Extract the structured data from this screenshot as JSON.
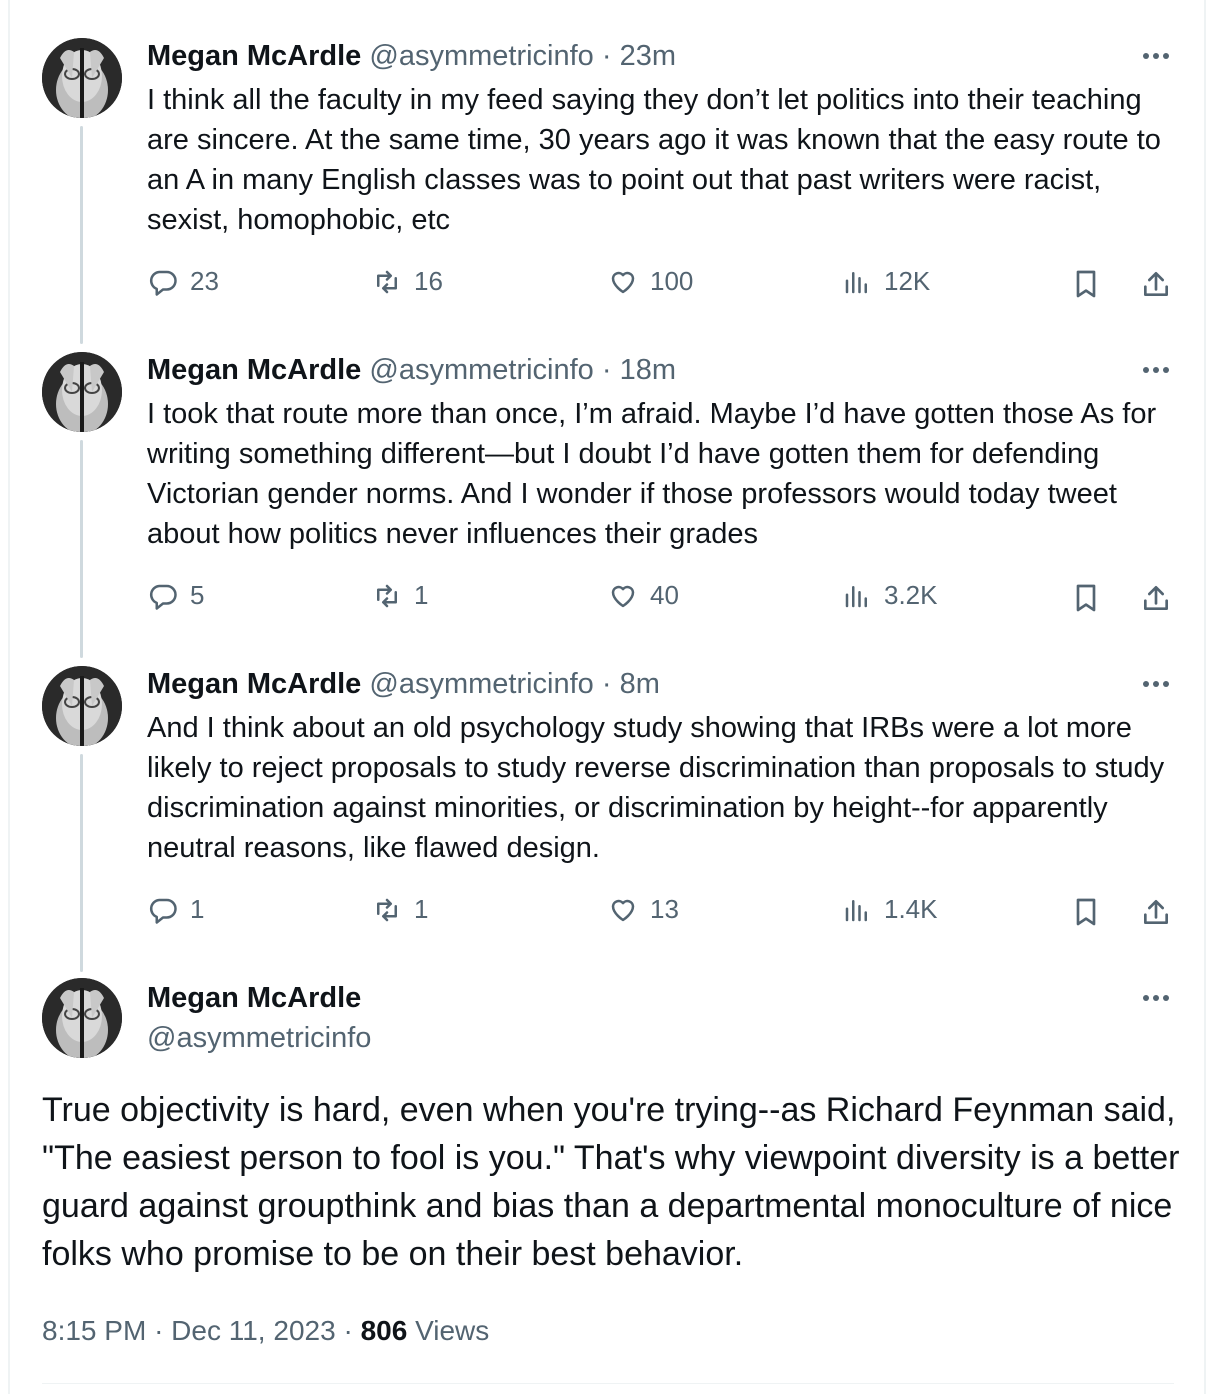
{
  "thread": [
    {
      "name": "Megan McArdle",
      "handle": "@asymmetricinfo",
      "dot": "·",
      "time": "23m",
      "text": "I think all the faculty in my feed saying they don’t let politics into their teaching are sincere. At the same time, 30 years ago it was known that the easy route to an A in many English classes was to point out that past writers were racist, sexist, homophobic, etc",
      "replies": "23",
      "reposts": "16",
      "likes": "100",
      "views": "12K"
    },
    {
      "name": "Megan McArdle",
      "handle": "@asymmetricinfo",
      "dot": "·",
      "time": "18m",
      "text": "I took that route more than once, I’m afraid. Maybe I’d have gotten those As for writing something different—but I doubt I’d have gotten them for defending Victorian gender norms. And I wonder if those professors would today tweet  about how politics never influences their grades",
      "replies": "5",
      "reposts": "1",
      "likes": "40",
      "views": "3.2K"
    },
    {
      "name": "Megan McArdle",
      "handle": "@asymmetricinfo",
      "dot": "·",
      "time": "8m",
      "text": "And I think about an old psychology study showing that IRBs were a lot more likely to reject proposals to study reverse discrimination than proposals to study discrimination against minorities, or discrimination by height--for apparently neutral reasons, like flawed design.",
      "replies": "1",
      "reposts": "1",
      "likes": "13",
      "views": "1.4K"
    }
  ],
  "main": {
    "name": "Megan McArdle",
    "handle": "@asymmetricinfo",
    "text": "True objectivity is hard, even when you're trying--as Richard Feynman said, \"The easiest person to fool is you.\" That's why viewpoint diversity is a better guard against groupthink and bias than a departmental monoculture of nice folks who promise to be on their best behavior.",
    "time": "8:15 PM",
    "sep1": "·",
    "date": "Dec 11, 2023",
    "sep2": "·",
    "views_count": "806",
    "views_label": "Views"
  },
  "icons": {
    "reply": "reply-icon",
    "repost": "repost-icon",
    "like": "heart-icon",
    "views": "analytics-icon",
    "bookmark": "bookmark-icon",
    "share": "share-icon",
    "more": "more-icon"
  },
  "colors": {
    "text": "#0f1419",
    "secondary": "#536471",
    "thread_line": "#cfd9de",
    "border": "#eff3f4"
  }
}
